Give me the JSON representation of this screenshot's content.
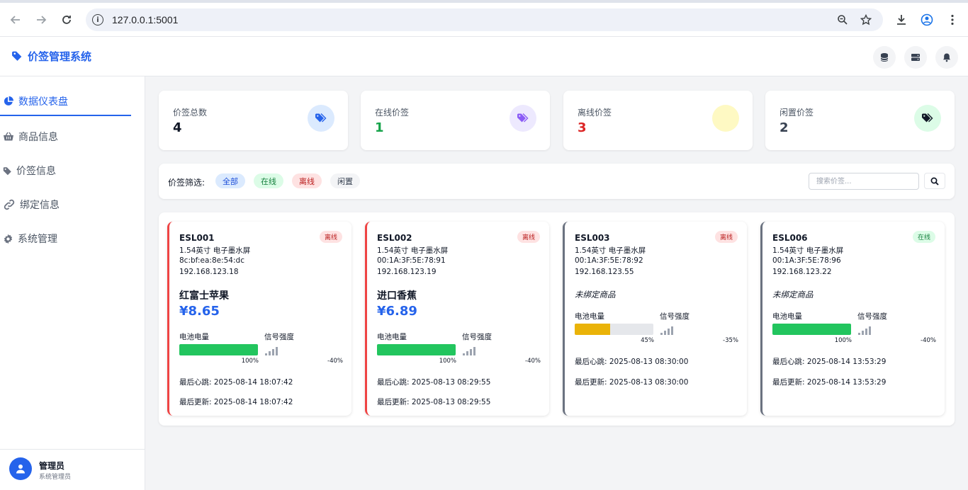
{
  "browser": {
    "url": "127.0.0.1:5001"
  },
  "app": {
    "title": "价签管理系统"
  },
  "sidebar": {
    "items": [
      {
        "label": "数据仪表盘",
        "icon": "chart-pie-icon",
        "active": true
      },
      {
        "label": "商品信息",
        "icon": "basket-icon",
        "active": false
      },
      {
        "label": "价签信息",
        "icon": "tag-icon",
        "active": false
      },
      {
        "label": "绑定信息",
        "icon": "link-icon",
        "active": false
      },
      {
        "label": "系统管理",
        "icon": "gear-icon",
        "active": false
      }
    ],
    "user": {
      "name": "管理员",
      "role": "系统管理员"
    }
  },
  "stats": [
    {
      "label": "价签总数",
      "value": "4",
      "color": "#111827",
      "icon": "tags-icon",
      "icon_bg": "#dbeafe",
      "icon_color": "#2563eb"
    },
    {
      "label": "在线价签",
      "value": "1",
      "color": "#16a34a",
      "icon": "tags-icon",
      "icon_bg": "#ede9fe",
      "icon_color": "#8b5cf6"
    },
    {
      "label": "离线价签",
      "value": "3",
      "color": "#dc2626",
      "icon": "",
      "icon_bg": "#fef9c3",
      "icon_color": "#eab308"
    },
    {
      "label": "闲置价签",
      "value": "2",
      "color": "#374151",
      "icon": "tags-icon",
      "icon_bg": "#dcfce7",
      "icon_color": "#111827"
    }
  ],
  "filter": {
    "label": "价签筛选:",
    "chips": [
      {
        "label": "全部",
        "bg": "#dbeafe",
        "color": "#1d4ed8"
      },
      {
        "label": "在线",
        "bg": "#dcfce7",
        "color": "#15803d"
      },
      {
        "label": "离线",
        "bg": "#fee2e2",
        "color": "#b91c1c"
      },
      {
        "label": "闲置",
        "bg": "#f3f4f6",
        "color": "#374151"
      }
    ],
    "search_placeholder": "搜索价签..."
  },
  "esl_cards": [
    {
      "id": "ESL001",
      "status": "离线",
      "online": false,
      "spec": "1.54英寸 电子墨水屏",
      "mac": "8c:bf:ea:8e:54:dc",
      "ip": "192.168.123.18",
      "product": "红富士苹果",
      "price": "¥8.65",
      "battery_label": "电池电量",
      "battery": 100,
      "battery_text": "100%",
      "battery_color": "#22c55e",
      "signal_label": "信号强度",
      "signal_text": "-40%",
      "heartbeat": "最后心跳: 2025-08-14 18:07:42",
      "updated": "最后更新: 2025-08-14 18:07:42"
    },
    {
      "id": "ESL002",
      "status": "离线",
      "online": false,
      "spec": "1.54英寸 电子墨水屏",
      "mac": "00:1A:3F:5E:78:91",
      "ip": "192.168.123.19",
      "product": "进口香蕉",
      "price": "¥6.89",
      "battery_label": "电池电量",
      "battery": 100,
      "battery_text": "100%",
      "battery_color": "#22c55e",
      "signal_label": "信号强度",
      "signal_text": "-40%",
      "heartbeat": "最后心跳: 2025-08-13 08:29:55",
      "updated": "最后更新: 2025-08-13 08:29:55"
    },
    {
      "id": "ESL003",
      "status": "离线",
      "online": false,
      "spec": "1.54英寸 电子墨水屏",
      "mac": "00:1A:3F:5E:78:92",
      "ip": "192.168.123.55",
      "unbound": "未绑定商品",
      "battery_label": "电池电量",
      "battery": 45,
      "battery_text": "45%",
      "battery_color": "#eab308",
      "signal_label": "信号强度",
      "signal_text": "-35%",
      "heartbeat": "最后心跳: 2025-08-13 08:30:00",
      "updated": "最后更新: 2025-08-13 08:30:00"
    },
    {
      "id": "ESL006",
      "status": "在线",
      "online": true,
      "spec": "1.54英寸 电子墨水屏",
      "mac": "00:1A:3F:5E:78:96",
      "ip": "192.168.123.22",
      "unbound": "未绑定商品",
      "battery_label": "电池电量",
      "battery": 100,
      "battery_text": "100%",
      "battery_color": "#22c55e",
      "signal_label": "信号强度",
      "signal_text": "-40%",
      "heartbeat": "最后心跳: 2025-08-14 13:53:29",
      "updated": "最后更新: 2025-08-14 13:53:29"
    }
  ]
}
